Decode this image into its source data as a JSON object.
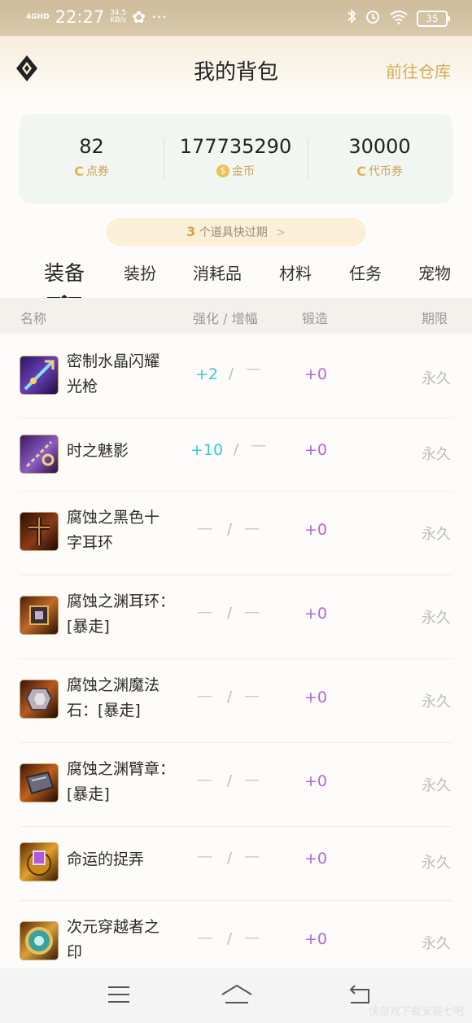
{
  "status_bar": {
    "network": "4GHD",
    "time": "22:27",
    "speed_value": "34.5",
    "speed_unit": "KB/s",
    "more": "···",
    "battery": "35"
  },
  "header": {
    "title": "我的背包",
    "warehouse_link": "前往仓库"
  },
  "stats": [
    {
      "value": "82",
      "label": "点券",
      "icon": "coupon-icon"
    },
    {
      "value": "177735290",
      "label": "金币",
      "icon": "gold-coin-icon"
    },
    {
      "value": "30000",
      "label": "代币券",
      "icon": "token-coupon-icon"
    }
  ],
  "expire_notice": {
    "count": "3",
    "text": "个道具快过期"
  },
  "tabs": [
    {
      "label": "装备",
      "active": true
    },
    {
      "label": "装扮",
      "active": false
    },
    {
      "label": "消耗品",
      "active": false
    },
    {
      "label": "材料",
      "active": false
    },
    {
      "label": "任务",
      "active": false
    },
    {
      "label": "宠物",
      "active": false
    }
  ],
  "table_header": {
    "name": "名称",
    "enhance": "强化 / 增幅",
    "forge": "锻造",
    "period": "期限"
  },
  "items": [
    {
      "name_l1": "密制水晶闪耀",
      "name_l2": "光枪",
      "enhance": "+2",
      "amplify": "—",
      "forge": "+0",
      "period": "永久",
      "icon": "crystal-lance-icon"
    },
    {
      "name_l1": "时之魅影",
      "name_l2": "",
      "enhance": "+10",
      "amplify": "—",
      "forge": "+0",
      "period": "永久",
      "icon": "chain-phantom-icon"
    },
    {
      "name_l1": "腐蚀之黑色十",
      "name_l2": "字耳环",
      "enhance": "—",
      "amplify": "—",
      "forge": "+0",
      "period": "永久",
      "icon": "black-cross-earring-icon"
    },
    {
      "name_l1": "腐蚀之渊耳环：",
      "name_l2": "[暴走]",
      "enhance": "—",
      "amplify": "—",
      "forge": "+0",
      "period": "永久",
      "icon": "abyss-earring-icon"
    },
    {
      "name_l1": "腐蚀之渊魔法",
      "name_l2": "石：[暴走]",
      "enhance": "—",
      "amplify": "—",
      "forge": "+0",
      "period": "永久",
      "icon": "abyss-magic-stone-icon"
    },
    {
      "name_l1": "腐蚀之渊臂章：",
      "name_l2": "[暴走]",
      "enhance": "—",
      "amplify": "—",
      "forge": "+0",
      "period": "永久",
      "icon": "abyss-armband-icon"
    },
    {
      "name_l1": "命运的捉弄",
      "name_l2": "",
      "enhance": "—",
      "amplify": "—",
      "forge": "+0",
      "period": "永久",
      "icon": "fate-trick-icon"
    },
    {
      "name_l1": "次元穿越者之",
      "name_l2": "印",
      "enhance": "—",
      "amplify": "—",
      "forge": "+0",
      "period": "永久",
      "icon": "dimension-seal-icon"
    }
  ],
  "watermark": "侠游戏下载安装七吧"
}
